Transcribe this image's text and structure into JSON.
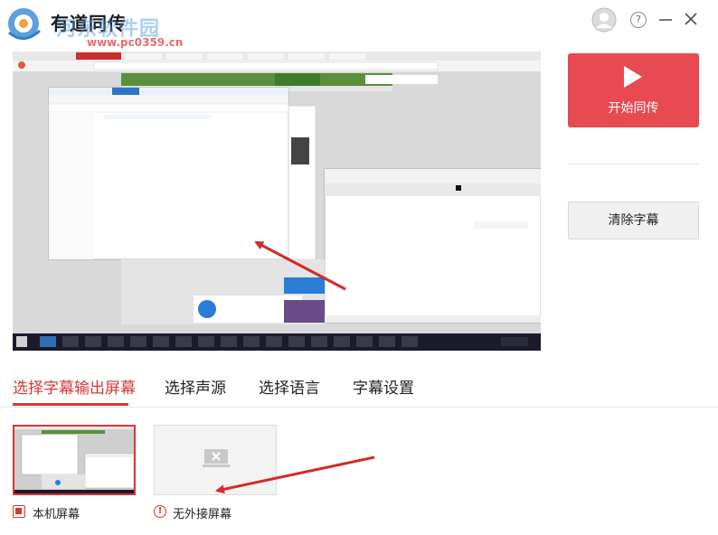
{
  "app": {
    "title": "有道同传",
    "watermark_text": "河东软件园",
    "watermark_url": "www.pc0359.cn"
  },
  "window_controls": {
    "help_glyph": "?",
    "avatar_icon": "user-avatar-icon",
    "minimize_icon": "minimize-icon",
    "close_icon": "close-icon"
  },
  "actions": {
    "start_label": "开始同传",
    "clear_label": "清除字幕"
  },
  "tabs": [
    {
      "label": "选择字幕输出屏幕",
      "active": true
    },
    {
      "label": "选择声源",
      "active": false
    },
    {
      "label": "选择语言",
      "active": false
    },
    {
      "label": "字幕设置",
      "active": false
    }
  ],
  "screens": {
    "local_label": "本机屏幕",
    "external_label": "无外接屏幕",
    "warn_glyph": "!"
  },
  "colors": {
    "accent": "#d93636",
    "start_button": "#e84a52",
    "arrow": "#d42a2a"
  }
}
